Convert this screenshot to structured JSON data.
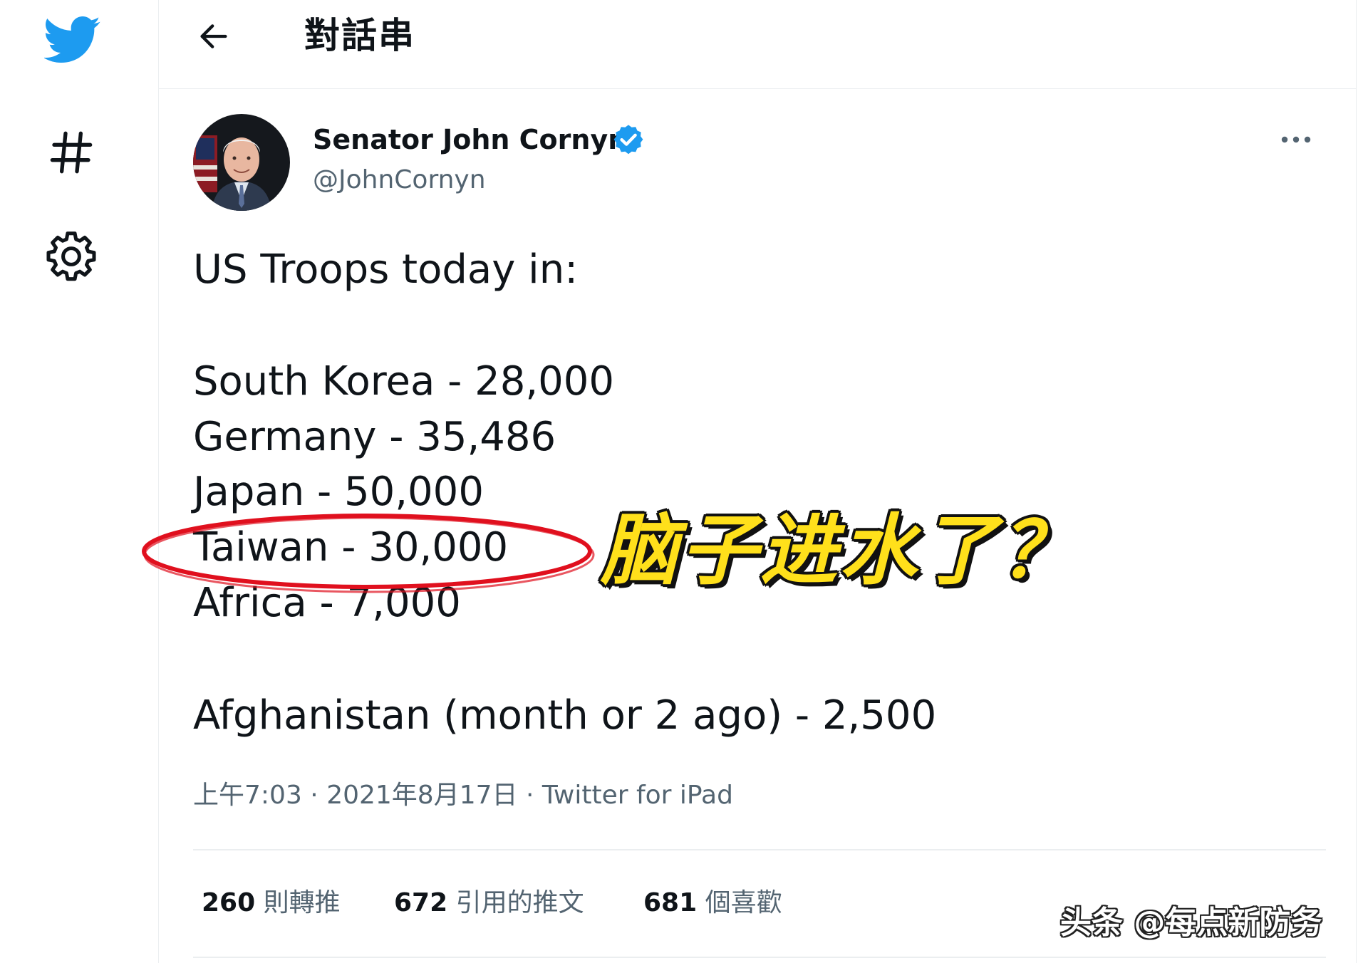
{
  "nav": {
    "icons": [
      "twitter-bird-icon",
      "hashtag-icon",
      "settings-gear-icon"
    ]
  },
  "header": {
    "title": "對話串",
    "back_icon": "back-arrow-icon"
  },
  "tweet": {
    "author": {
      "name": "Senator John Cornyn",
      "handle": "@JohnCornyn",
      "verified": true
    },
    "lines": {
      "intro": "US Troops today in:",
      "south_korea": "South Korea - 28,000",
      "germany": "Germany - 35,486",
      "japan": "Japan - 50,000",
      "taiwan": "Taiwan - 30,000",
      "africa": "Africa - 7,000",
      "afghanistan": "Afghanistan (month or 2 ago) - 2,500"
    },
    "meta": {
      "time": "上午7:03",
      "separator": " · ",
      "date": "2021年8月17日",
      "source": "Twitter for iPad"
    },
    "stats": {
      "retweets": {
        "count": "260",
        "label": "則轉推"
      },
      "quotes": {
        "count": "672",
        "label": "引用的推文"
      },
      "likes": {
        "count": "681",
        "label": "個喜歡"
      }
    }
  },
  "overlay": {
    "annotation": "脑子进水了？",
    "watermark": "头条 @每点新防务"
  },
  "colors": {
    "twitter_blue": "#1d9bf0",
    "text_primary": "#0f1419",
    "text_secondary": "#536471",
    "divider": "#ebeef0",
    "highlight_red": "#e0101e",
    "annotation_yellow": "#ffe01b"
  }
}
